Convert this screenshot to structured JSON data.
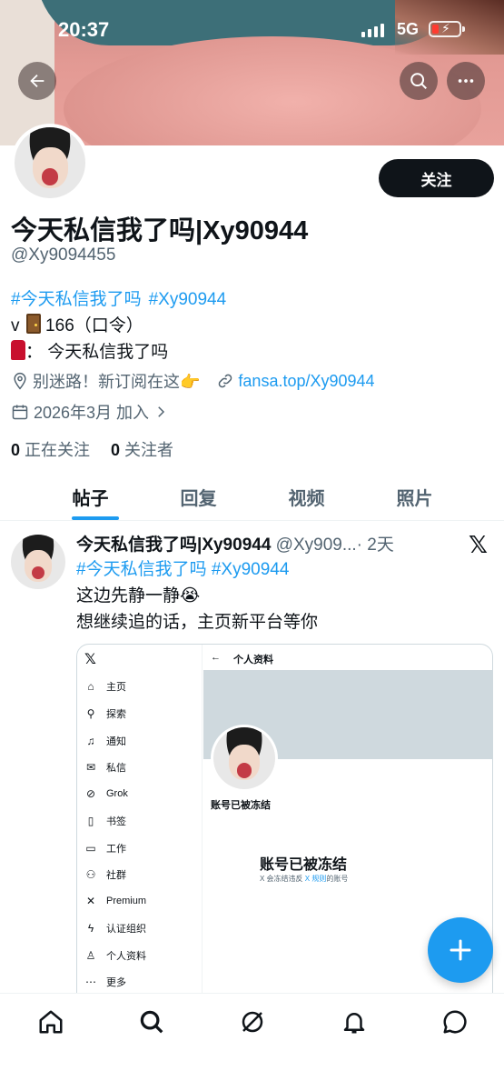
{
  "status_bar": {
    "time": "20:37",
    "network": "5G"
  },
  "profile": {
    "name": "今天私信我了吗|Xy90944",
    "handle": "@Xy9094455",
    "follow_label": "关注",
    "bio_tags": [
      "#今天私信我了吗",
      "#Xy90944"
    ],
    "bio_line2_prefix": "v",
    "bio_line2_suffix": " 166（口令）",
    "bio_line3": "：  今天私信我了吗",
    "location": "别迷路！新订阅在这👉",
    "website": "fansa.top/Xy90944",
    "joined": "2026年3月 加入",
    "following_count": "0",
    "following_label": "正在关注",
    "followers_count": "0",
    "followers_label": "关注者"
  },
  "tabs": [
    {
      "label": "帖子",
      "active": true
    },
    {
      "label": "回复"
    },
    {
      "label": "视频"
    },
    {
      "label": "照片"
    }
  ],
  "post": {
    "author_name": "今天私信我了吗|Xy90944",
    "author_handle": "@Xy909...",
    "time": "· 2天",
    "tags": [
      "#今天私信我了吗",
      "#Xy90944"
    ],
    "line1": "这边先静一静😭",
    "line2": "想继续追的话，主页新平台等你"
  },
  "embedded": {
    "logo": "𝕏",
    "topbar_title": "个人资料",
    "nav": [
      {
        "icon": "home",
        "label": "主页"
      },
      {
        "icon": "search",
        "label": "探索"
      },
      {
        "icon": "bell",
        "label": "通知"
      },
      {
        "icon": "mail",
        "label": "私信"
      },
      {
        "icon": "grok",
        "label": "Grok"
      },
      {
        "icon": "bookmark",
        "label": "书签"
      },
      {
        "icon": "briefcase",
        "label": "工作"
      },
      {
        "icon": "people",
        "label": "社群"
      },
      {
        "icon": "x",
        "label": "Premium"
      },
      {
        "icon": "bolt",
        "label": "认证组织"
      },
      {
        "icon": "person",
        "label": "个人资料"
      },
      {
        "icon": "more",
        "label": "更多"
      }
    ],
    "frozen_small": "账号已被冻结",
    "frozen_big": "账号已被冻结",
    "frozen_sub_pre": "X 会冻结违反 ",
    "frozen_sub_link": "X 规则",
    "frozen_sub_post": "的账号"
  },
  "colors": {
    "accent": "#1d9bf0",
    "text": "#0f1419",
    "secondary": "#536471"
  }
}
